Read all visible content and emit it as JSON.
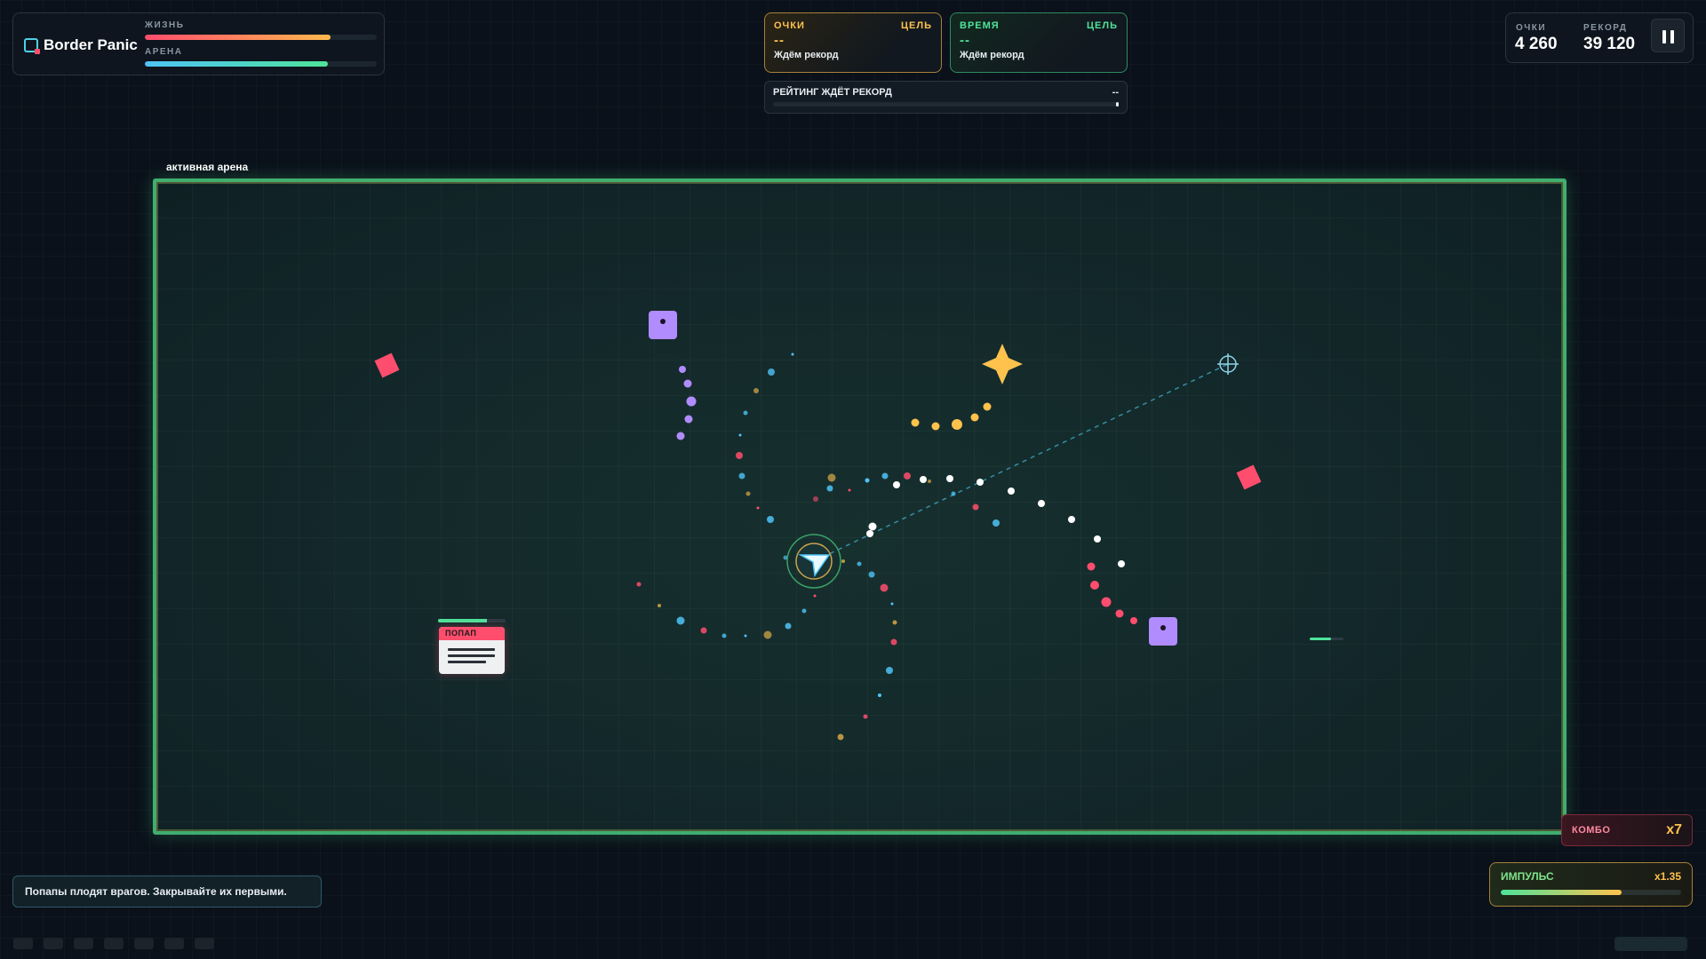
{
  "game": {
    "title": "Border Panic",
    "life_label": "ЖИЗНЬ",
    "life_level": 0.8,
    "arena_label": "АРЕНА",
    "arena_level": 0.79
  },
  "goals": {
    "score": {
      "label": "ОЧКИ",
      "goal_label": "ЦЕЛЬ",
      "value": "--",
      "status": "Ждём рекорд"
    },
    "time": {
      "label": "ВРЕМЯ",
      "goal_label": "ЦЕЛЬ",
      "value": "--",
      "status": "Ждём рекорд"
    }
  },
  "rating": {
    "label": "РЕЙТИНГ ЖДЁТ РЕКОРД",
    "value": "--"
  },
  "scoreboard": {
    "score_label": "ОЧКИ",
    "score_value": "4 260",
    "record_label": "РЕКОРД",
    "record_value": "39 120"
  },
  "arena": {
    "caption": "активная арена",
    "popup_label": "ПОПАП",
    "popup_health": 0.72
  },
  "combo": {
    "label": "КОМБО",
    "value": "x7"
  },
  "impulse": {
    "label": "ИМПУЛЬС",
    "value": "x1.35",
    "level": 0.67
  },
  "hint": "Попапы плодят врагов. Закрывайте их первыми.",
  "colors": {
    "accent_green": "#3fae6f",
    "enemy_red": "#ff4d6d",
    "enemy_purple": "#b18cff",
    "gold": "#ffc24d",
    "cyan": "#4fc3f7"
  },
  "icons": {
    "player": "arrow-ship-icon",
    "crosshair": "crosshair-icon",
    "pause": "pause-icon",
    "star_pickup": "star-icon"
  }
}
